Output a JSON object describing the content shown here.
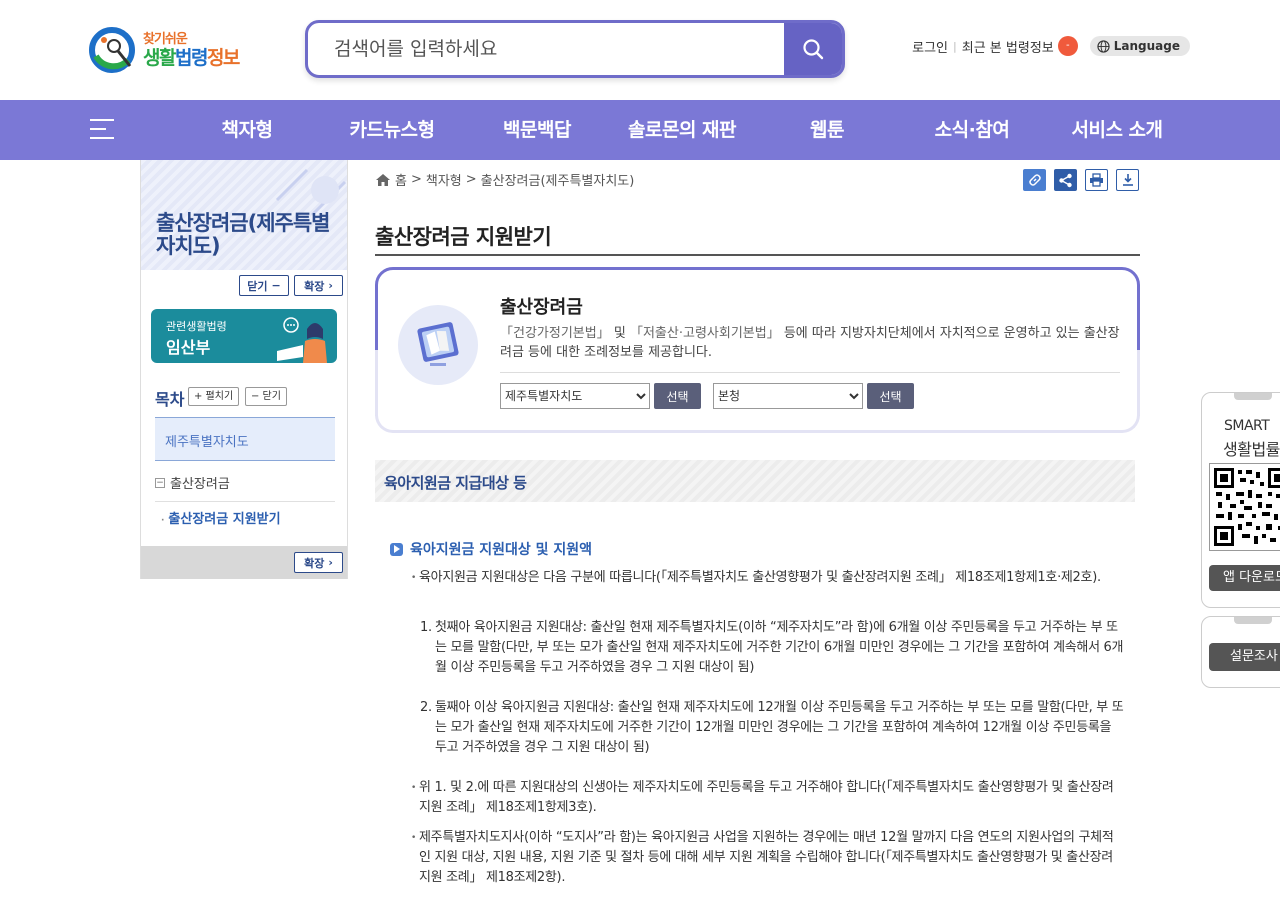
{
  "header": {
    "logo_small": "찾기쉬운",
    "logo_big_1": "생활",
    "logo_big_2": "법령",
    "logo_big_3": "정보",
    "search_placeholder": "검색어를 입력하세요",
    "login": "로그인",
    "recent": "최근 본 법령정보",
    "recent_count": "-",
    "language": "Language"
  },
  "nav": {
    "items": [
      "책자형",
      "카드뉴스형",
      "백문백답",
      "솔로몬의 재판",
      "웹툰",
      "소식·참여",
      "서비스 소개"
    ]
  },
  "sidebar": {
    "title": "출산장려금(제주특별자치도)",
    "close_btn": "닫기",
    "expand_btn": "확장",
    "banner_sub": "관련생활법령",
    "banner_main": "임산부",
    "toc_label": "목차",
    "toc_expand": "+ 펼치기",
    "toc_collapse": "− 닫기",
    "toc_items": [
      "제주특별자치도",
      "출산장려금",
      "출산장려금 지원받기"
    ],
    "footer_expand": "확장"
  },
  "breadcrumb": {
    "home": "홈",
    "sep": ">",
    "level1": "책자형",
    "level2": "출산장려금(제주특별자치도)"
  },
  "page": {
    "title": "출산장려금 지원받기"
  },
  "intro": {
    "title": "출산장려금",
    "law1": "「건강가정기본법」",
    "conj": " 및 ",
    "law2": "「저출산·고령사회기본법」",
    "desc_rest": " 등에 따라 지방자치단체에서 자치적으로 운영하고 있는 출산장려금 등에 대한 조례정보를 제공합니다.",
    "select1_value": "제주특별자치도",
    "select2_value": "본청",
    "select_btn": "선택"
  },
  "content": {
    "section_title": "육아지원금 지급대상 등",
    "sub_title": "육아지원금 지원대상 및 지원액",
    "p1": "육아지원금 지원대상은 다음 구분에 따릅니다(「제주특별자치도 출산영향평가 및 출산장려지원 조례」 제18조제1항제1호·제2호).",
    "n1_num": "1.",
    "n1": "첫째아 육아지원금 지원대상: 출산일 현재 제주특별자치도(이하 “제주자치도”라 함)에 6개월 이상 주민등록을 두고 거주하는 부 또는 모를 말함(다만, 부 또는 모가 출산일 현재 제주자치도에 거주한 기간이 6개월 미만인 경우에는 그 기간을 포함하여 계속해서 6개월 이상 주민등록을 두고 거주하였을 경우 그 지원 대상이 됨)",
    "n2_num": "2.",
    "n2": "둘째아 이상 육아지원금 지원대상: 출산일 현재 제주자치도에 12개월 이상 주민등록을 두고 거주하는 부 또는 모를 말함(다만, 부 또는 모가 출산일 현재 제주자치도에 거주한 기간이 12개월 미만인 경우에는 그 기간을 포함하여 계속하여 12개월 이상 주민등록을 두고 거주하였을 경우 그 지원 대상이 됨)",
    "p2": "위 1. 및 2.에 따른 지원대상의 신생아는 제주자치도에 주민등록을 두고 거주해야 합니다(「제주특별자치도 출산영향평가 및 출산장려지원 조례」 제18조제1항제3호).",
    "p3": "제주특별자치도지사(이하 “도지사”라 함)는 육아지원금 사업을 지원하는 경우에는 매년 12월 말까지 다음 연도의 지원사업의 구체적인 지원 대상, 지원 내용, 지원 기준 및 절차 등에 대해 세부 지원 계획을 수립해야 합니다(「제주특별자치도 출산영향평가 및 출산장려지원 조례」 제18조제2항)."
  },
  "widgets": {
    "smart": "SMART",
    "life_law": "생활법률",
    "app_download": "앱 다운로드",
    "survey": "설문조사"
  },
  "colors": {
    "nav_bg": "#7b78d6",
    "accent": "#6663c4",
    "sidebar_title": "#2c4a8a",
    "link_blue": "#2c5fb0"
  }
}
